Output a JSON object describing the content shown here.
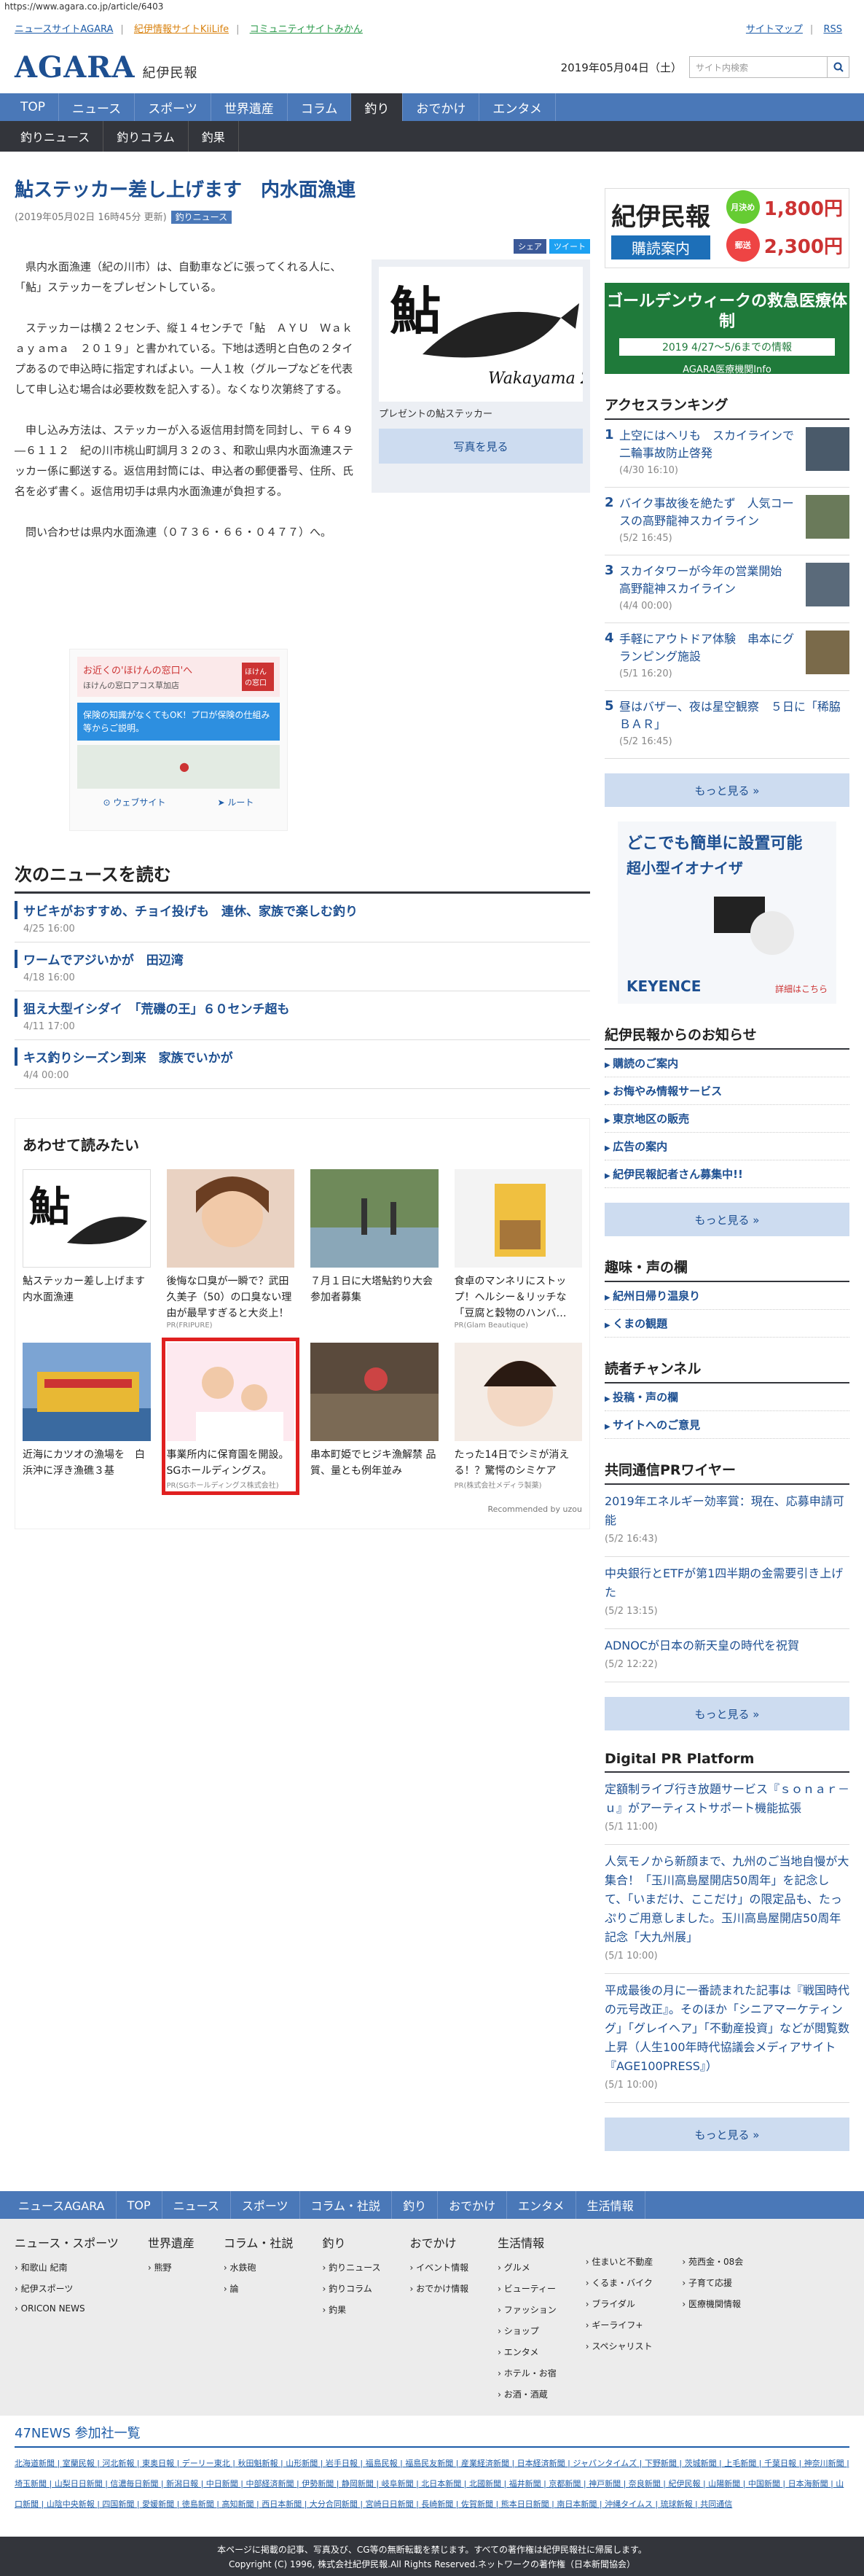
{
  "url": "https://www.agara.co.jp/article/6403",
  "top_links": [
    "ニュースサイトAGARA",
    "紀伊情報サイトKiiLife",
    "コミュニティサイトみかん"
  ],
  "top_right": [
    "サイトマップ",
    "RSS"
  ],
  "logo": "AGARA",
  "logo_sub": "紀伊民報",
  "date": "2019年05月04日（土）",
  "search_placeholder": "サイト内検索",
  "nav": [
    "TOP",
    "ニュース",
    "スポーツ",
    "世界遺産",
    "コラム",
    "釣り",
    "おでかけ",
    "エンタメ"
  ],
  "subnav": [
    "釣りニュース",
    "釣りコラム",
    "釣果"
  ],
  "article": {
    "title": "鮎ステッカー差し上げます　内水面漁連",
    "meta": "(2019年05月02日 16時45分 更新)",
    "badge": "釣りニュース",
    "share": [
      "シェア",
      "ツイート"
    ],
    "paragraphs": [
      "県内水面漁連（紀の川市）は、自動車などに張ってくれる人に、「鮎」ステッカーをプレゼントしている。",
      "ステッカーは横２２センチ、縦１４センチで「鮎　ＡＹＵ　Ｗａｋａｙａｍａ　２０１９」と書かれている。下地は透明と白色の２タイプあるので申込時に指定すればよい。一人１枚（グループなどを代表して申し込む場合は必要枚数を記入する）。なくなり次第終了する。",
      "申し込み方法は、ステッカーが入る返信用封筒を同封し、〒６４９―６１１２　紀の川市桃山町調月３２の３、和歌山県内水面漁連ステッカー係に郵送する。返信用封筒には、申込者の郵便番号、住所、氏名を必ず書く。返信用切手は県内水面漁連が負担する。",
      "問い合わせは県内水面漁連（０７３６・６６・０４７７）へ。"
    ],
    "photo_caption": "プレゼントの鮎ステッカー",
    "photo_btn": "写真を見る"
  },
  "ad1": {
    "title": "お近くの'ほけんの窓口'へ",
    "sub": "ほけんの窓口アコス草加店",
    "badge": "ほけんの窓口",
    "blue": "保険の知識がなくてもOK！プロが保険の仕組み等からご説明。",
    "btns": [
      "ウェブサイト",
      "ルート"
    ]
  },
  "next_heading": "次のニュースを読む",
  "next_news": [
    {
      "t": "サビキがおすすめ、チョイ投げも　連休、家族で楽しむ釣り",
      "d": "4/25 16:00"
    },
    {
      "t": "ワームでアジいかが　田辺湾",
      "d": "4/18 16:00"
    },
    {
      "t": "狙え大型イシダイ　「荒磯の王」６０センチ超も",
      "d": "4/11 17:00"
    },
    {
      "t": "キス釣りシーズン到来　家族でいかが",
      "d": "4/4 00:00"
    }
  ],
  "rec_heading": "あわせて読みたい",
  "rec": [
    {
      "t": "鮎ステッカー差し上げます　内水面漁連",
      "pr": ""
    },
    {
      "t": "後悔な口臭が一瞬で？武田久美子（50）の口臭ない理由が最早すぎると大炎上！",
      "pr": "PR(FRIPURE)"
    },
    {
      "t": "７月１日に大塔鮎釣り大会　参加者募集",
      "pr": ""
    },
    {
      "t": "食卓のマンネリにストップ！ヘルシー＆リッチな「豆腐と穀物のハンバ…",
      "pr": "PR(Glam Beautique)"
    },
    {
      "t": "近海にカツオの漁場を　白浜沖に浮き漁礁３基",
      "pr": ""
    },
    {
      "t": "事業所内に保育園を開設。SGホールディングス。",
      "pr": "PR(SGホールディングス株式会社)"
    },
    {
      "t": "串本町姫でヒジキ漁解禁 品質、量とも例年並み",
      "pr": ""
    },
    {
      "t": "たった14日でシミが消える！？驚愕のシミケア",
      "pr": "PR(株式会社メディラ製薬)"
    }
  ],
  "rec_foot": "Recommended by uzou",
  "side_ad": {
    "logo": "紀伊民報",
    "buy": "購読案内",
    "prices": [
      {
        "b": "月決め",
        "p": "1,800円"
      },
      {
        "b": "郵送",
        "p": "2,300円"
      }
    ]
  },
  "gw": {
    "a": "ゴールデンウィークの救急医療体制",
    "b": "2019 4/27〜5/6までの情報",
    "c": "AGARA医療機関Info"
  },
  "ranking_heading": "アクセスランキング",
  "ranking": [
    {
      "n": "1",
      "t": "上空にはヘリも　スカイラインで二輪事故防止啓発",
      "d": "(4/30 16:10)"
    },
    {
      "n": "2",
      "t": "バイク事故後を絶たず　人気コースの高野龍神スカイライン",
      "d": "(5/2 16:45)"
    },
    {
      "n": "3",
      "t": "スカイタワーが今年の営業開始　高野龍神スカイライン",
      "d": "(4/4 00:00)"
    },
    {
      "n": "4",
      "t": "手軽にアウトドア体験　串本にグランピング施設",
      "d": "(5/1 16:20)"
    },
    {
      "n": "5",
      "t": "昼はバザー、夜は星空観察　５日に「稀脇ＢＡＲ」",
      "d": "(5/2 16:45)"
    }
  ],
  "more": "もっと見る »",
  "ad3": {
    "a": "どこでも簡単に設置可能",
    "b": "超小型イオナイザ",
    "k": "KEYENCE",
    "s": "詳細はこちら"
  },
  "notice_heading": "紀伊民報からのお知らせ",
  "notices": [
    "購読のご案内",
    "お悔やみ情報サービス",
    "東京地区の販売",
    "広告の案内",
    "紀伊民報記者さん募集中!!"
  ],
  "hobby_heading": "趣味・声の欄",
  "hobby": [
    "紀州日帰り温泉り",
    "くまの観題"
  ],
  "reader_heading": "読者チャンネル",
  "reader": [
    "投稿・声の欄",
    "サイトへのご意見"
  ],
  "pr_heading": "共同通信PRワイヤー",
  "pr": [
    {
      "t": "2019年エネルギー効率賞：現在、応募申請可能",
      "d": "(5/2 16:43)"
    },
    {
      "t": "中央銀行とETFが第1四半期の金需要引き上げた",
      "d": "(5/2 13:15)"
    },
    {
      "t": "ADNOCが日本の新天皇の時代を祝賀",
      "d": "(5/2 12:22)"
    }
  ],
  "dpr_heading": "Digital PR Platform",
  "dpr": [
    {
      "t": "定額制ライブ行き放題サービス『ｓｏｎａｒ－ｕ』がアーティストサポート機能拡張",
      "d": "(5/1 11:00)"
    },
    {
      "t": "人気モノから新顔まで、九州のご当地自慢が大集合！「玉川高島屋開店50周年」を記念して、「いまだけ、ここだけ」の限定品も、たっぷりご用意しました。玉川高島屋開店50周年記念「大九州展」",
      "d": "(5/1 10:00)"
    },
    {
      "t": "平成最後の月に一番読まれた記事は『戦国時代の元号改正』。そのほか「シニアマーケティング」「グレイヘア」「不動産投資」などが閲覧数上昇（人生100年時代協議会メディアサイト『AGE100PRESS』）",
      "d": "(5/1 10:00)"
    }
  ],
  "foot_nav": [
    "ニュースAGARA",
    "TOP",
    "ニュース",
    "スポーツ",
    "コラム・社説",
    "釣り",
    "おでかけ",
    "エンタメ",
    "生活情報"
  ],
  "foot_cols": [
    {
      "h": "ニュース・スポーツ",
      "i": [
        "和歌山 紀南",
        "紀伊スポーツ",
        "ORICON NEWS"
      ]
    },
    {
      "h": "世界遺産",
      "i": [
        "熊野"
      ]
    },
    {
      "h": "コラム・社説",
      "i": [
        "水鉄砲",
        "論"
      ]
    },
    {
      "h": "釣り",
      "i": [
        "釣りニュース",
        "釣りコラム",
        "釣果"
      ]
    },
    {
      "h": "おでかけ",
      "i": [
        "イベント情報",
        "おでかけ情報"
      ]
    },
    {
      "h": "生活情報",
      "i": [
        "グルメ",
        "ビューティー",
        "ファッション",
        "ショップ",
        "エンタメ",
        "ホテル・お宿",
        "お酒・酒蔵"
      ]
    },
    {
      "h": "",
      "i": [
        "住まいと不動産",
        "くるま・バイク",
        "ブライダル",
        "ギーライフ+",
        "スペシャリスト"
      ]
    },
    {
      "h": "",
      "i": [
        "苑西金・08会",
        "子育て応援",
        "医療機関情報"
      ]
    }
  ],
  "n47_heading": "47NEWS 参加社一覧",
  "n47_list": "北海道新聞 | 室蘭民報 | 河北新報 | 東奥日報 | デーリー東北 | 秋田魁新報 | 山形新聞 | 岩手日報 | 福島民報 | 福島民友新聞 | 産業経済新聞 | 日本経済新聞 | ジャパンタイムズ | 下野新聞 | 茨城新聞 | 上毛新聞 | 千葉日報 | 神奈川新聞 | 埼玉新聞 | 山梨日日新聞 | 信濃毎日新聞 | 新潟日報 | 中日新聞 | 中部経済新聞 | 伊勢新聞 | 静岡新聞 | 岐阜新聞 | 北日本新聞 | 北國新聞 | 福井新聞 | 京都新聞 | 神戸新聞 | 奈良新聞 | 紀伊民報 | 山陽新聞 | 中国新聞 | 日本海新聞 | 山口新聞 | 山陰中央新報 | 四国新聞 | 愛媛新聞 | 徳島新聞 | 高知新聞 | 西日本新聞 | 大分合同新聞 | 宮崎日日新聞 | 長崎新聞 | 佐賀新聞 | 熊本日日新聞 | 南日本新聞 | 沖縄タイムス | 琉球新報 | 共同通信",
  "copy": [
    "本ページに掲載の記事、写真及び、CG等の無断転載を禁じます。すべての著作権は紀伊民報社に帰属します。",
    "Copyright (C) 1996, 株式会社紀伊民報.All Rights Reserved.ネットワークの著作権（日本新聞協会）"
  ]
}
